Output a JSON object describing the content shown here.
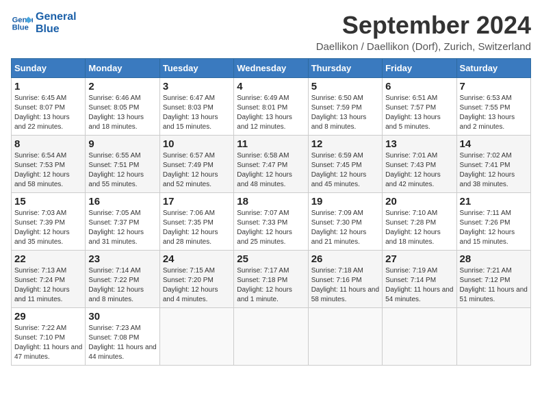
{
  "logo": {
    "line1": "General",
    "line2": "Blue"
  },
  "title": "September 2024",
  "subtitle": "Daellikon / Daellikon (Dorf), Zurich, Switzerland",
  "days_of_week": [
    "Sunday",
    "Monday",
    "Tuesday",
    "Wednesday",
    "Thursday",
    "Friday",
    "Saturday"
  ],
  "weeks": [
    [
      {
        "day": "1",
        "sunrise": "6:45 AM",
        "sunset": "8:07 PM",
        "daylight": "13 hours and 22 minutes."
      },
      {
        "day": "2",
        "sunrise": "6:46 AM",
        "sunset": "8:05 PM",
        "daylight": "13 hours and 18 minutes."
      },
      {
        "day": "3",
        "sunrise": "6:47 AM",
        "sunset": "8:03 PM",
        "daylight": "13 hours and 15 minutes."
      },
      {
        "day": "4",
        "sunrise": "6:49 AM",
        "sunset": "8:01 PM",
        "daylight": "13 hours and 12 minutes."
      },
      {
        "day": "5",
        "sunrise": "6:50 AM",
        "sunset": "7:59 PM",
        "daylight": "13 hours and 8 minutes."
      },
      {
        "day": "6",
        "sunrise": "6:51 AM",
        "sunset": "7:57 PM",
        "daylight": "13 hours and 5 minutes."
      },
      {
        "day": "7",
        "sunrise": "6:53 AM",
        "sunset": "7:55 PM",
        "daylight": "13 hours and 2 minutes."
      }
    ],
    [
      {
        "day": "8",
        "sunrise": "6:54 AM",
        "sunset": "7:53 PM",
        "daylight": "12 hours and 58 minutes."
      },
      {
        "day": "9",
        "sunrise": "6:55 AM",
        "sunset": "7:51 PM",
        "daylight": "12 hours and 55 minutes."
      },
      {
        "day": "10",
        "sunrise": "6:57 AM",
        "sunset": "7:49 PM",
        "daylight": "12 hours and 52 minutes."
      },
      {
        "day": "11",
        "sunrise": "6:58 AM",
        "sunset": "7:47 PM",
        "daylight": "12 hours and 48 minutes."
      },
      {
        "day": "12",
        "sunrise": "6:59 AM",
        "sunset": "7:45 PM",
        "daylight": "12 hours and 45 minutes."
      },
      {
        "day": "13",
        "sunrise": "7:01 AM",
        "sunset": "7:43 PM",
        "daylight": "12 hours and 42 minutes."
      },
      {
        "day": "14",
        "sunrise": "7:02 AM",
        "sunset": "7:41 PM",
        "daylight": "12 hours and 38 minutes."
      }
    ],
    [
      {
        "day": "15",
        "sunrise": "7:03 AM",
        "sunset": "7:39 PM",
        "daylight": "12 hours and 35 minutes."
      },
      {
        "day": "16",
        "sunrise": "7:05 AM",
        "sunset": "7:37 PM",
        "daylight": "12 hours and 31 minutes."
      },
      {
        "day": "17",
        "sunrise": "7:06 AM",
        "sunset": "7:35 PM",
        "daylight": "12 hours and 28 minutes."
      },
      {
        "day": "18",
        "sunrise": "7:07 AM",
        "sunset": "7:33 PM",
        "daylight": "12 hours and 25 minutes."
      },
      {
        "day": "19",
        "sunrise": "7:09 AM",
        "sunset": "7:30 PM",
        "daylight": "12 hours and 21 minutes."
      },
      {
        "day": "20",
        "sunrise": "7:10 AM",
        "sunset": "7:28 PM",
        "daylight": "12 hours and 18 minutes."
      },
      {
        "day": "21",
        "sunrise": "7:11 AM",
        "sunset": "7:26 PM",
        "daylight": "12 hours and 15 minutes."
      }
    ],
    [
      {
        "day": "22",
        "sunrise": "7:13 AM",
        "sunset": "7:24 PM",
        "daylight": "12 hours and 11 minutes."
      },
      {
        "day": "23",
        "sunrise": "7:14 AM",
        "sunset": "7:22 PM",
        "daylight": "12 hours and 8 minutes."
      },
      {
        "day": "24",
        "sunrise": "7:15 AM",
        "sunset": "7:20 PM",
        "daylight": "12 hours and 4 minutes."
      },
      {
        "day": "25",
        "sunrise": "7:17 AM",
        "sunset": "7:18 PM",
        "daylight": "12 hours and 1 minute."
      },
      {
        "day": "26",
        "sunrise": "7:18 AM",
        "sunset": "7:16 PM",
        "daylight": "11 hours and 58 minutes."
      },
      {
        "day": "27",
        "sunrise": "7:19 AM",
        "sunset": "7:14 PM",
        "daylight": "11 hours and 54 minutes."
      },
      {
        "day": "28",
        "sunrise": "7:21 AM",
        "sunset": "7:12 PM",
        "daylight": "11 hours and 51 minutes."
      }
    ],
    [
      {
        "day": "29",
        "sunrise": "7:22 AM",
        "sunset": "7:10 PM",
        "daylight": "11 hours and 47 minutes."
      },
      {
        "day": "30",
        "sunrise": "7:23 AM",
        "sunset": "7:08 PM",
        "daylight": "11 hours and 44 minutes."
      },
      null,
      null,
      null,
      null,
      null
    ]
  ]
}
